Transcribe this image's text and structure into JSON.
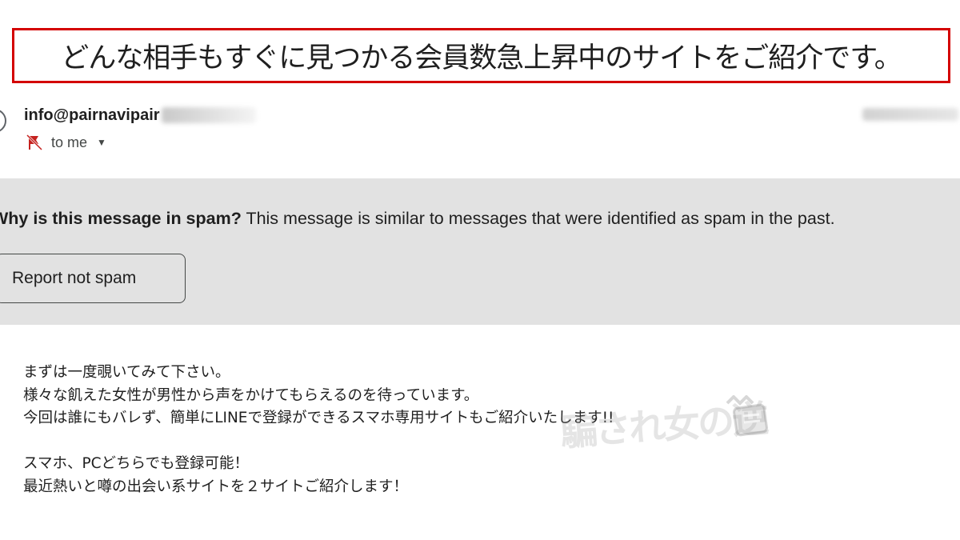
{
  "subject": {
    "text": "どんな相手もすぐに見つかる会員数急上昇中のサイトをご紹介です。"
  },
  "sender": {
    "name_visible": "info@pairnavipair"
  },
  "recipient": {
    "label": "to me",
    "icon": "spam-report-icon",
    "menu_icon": "chevron-down-icon"
  },
  "spam_notice": {
    "heading": "Why is this message in spam?",
    "explanation": " This message is similar to messages that were identified as spam in the past.",
    "report_button": "Report not spam"
  },
  "body": {
    "lines": [
      "まずは一度覗いてみて下さい。",
      "様々な飢えた女性が男性から声をかけてもらえるのを待っています。",
      "今回は誰にもバレず、簡単にLINEで登録ができるスマホ専用サイトもご紹介いたします!!",
      "",
      "スマホ、PCどちらでも登録可能！",
      "最近熱いと噂の出会い系サイトを２サイトご紹介します！"
    ]
  },
  "watermark": {
    "text": "騙され女の逆"
  },
  "colors": {
    "subject_border": "#d40000",
    "spam_panel_bg": "#e2e2e2",
    "spam_icon": "#c5221f",
    "text": "#1f1f1f"
  }
}
